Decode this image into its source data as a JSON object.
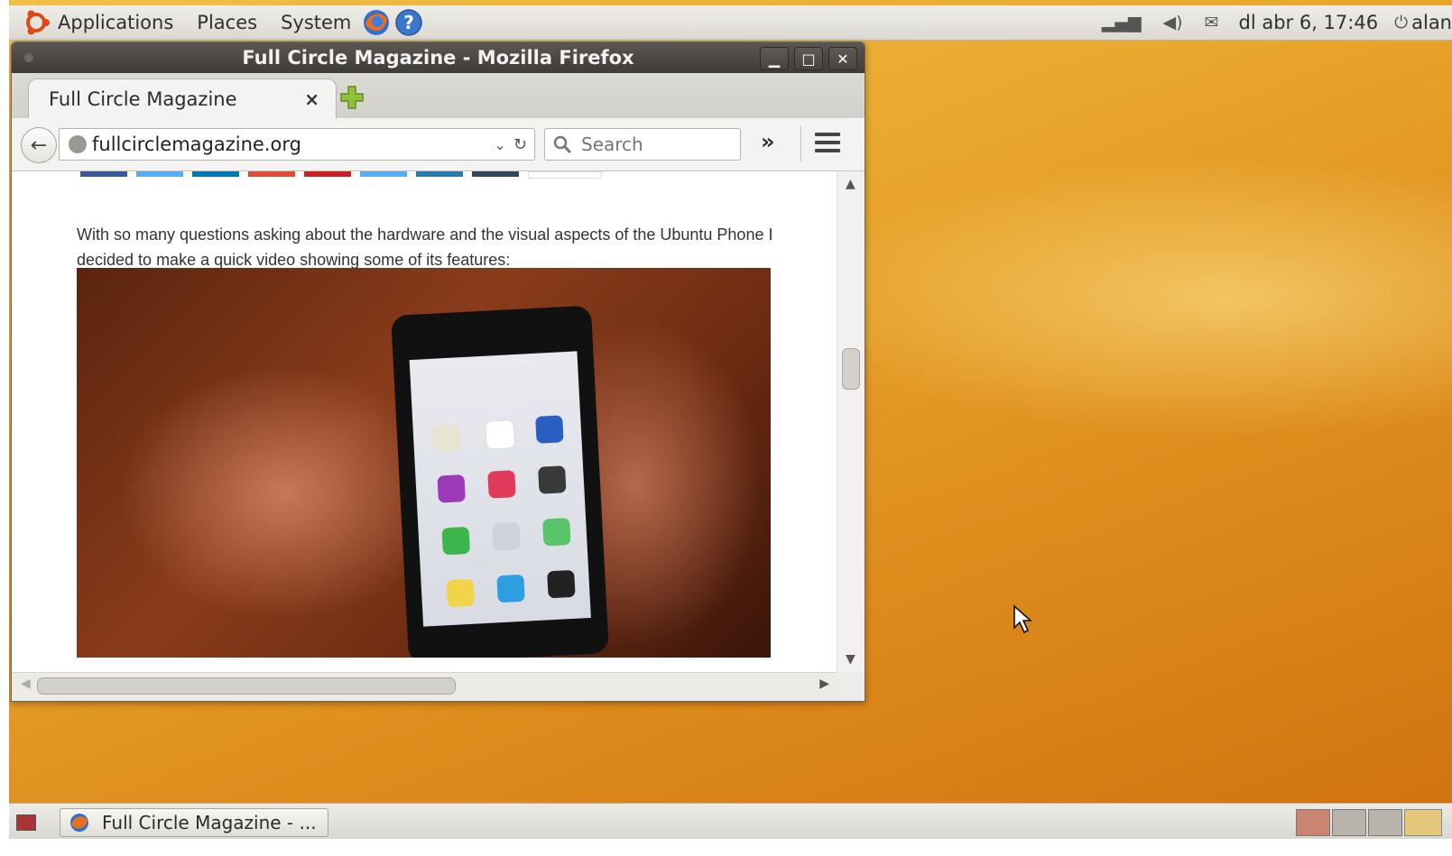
{
  "top_panel": {
    "menus": [
      "Applications",
      "Places",
      "System"
    ],
    "clock": "dl abr  6, 17:46",
    "user": "alan"
  },
  "window": {
    "title": "Full Circle Magazine - Mozilla Firefox",
    "tab_label": "Full Circle Magazine",
    "url": "fullcirclemagazine.org",
    "search_placeholder": "Search"
  },
  "article": {
    "text": "With so many questions asking about the hardware and the visual aspects of the Ubuntu Phone I decided to make a quick video showing some of its features:"
  },
  "share_colors": [
    "#3b5998",
    "#55acee",
    "#0077b5",
    "#dd4b39",
    "#cb2027",
    "#55acee",
    "#2a7ab0",
    "#35465c"
  ],
  "taskbar": {
    "task_label": "Full Circle Magazine - ..."
  }
}
